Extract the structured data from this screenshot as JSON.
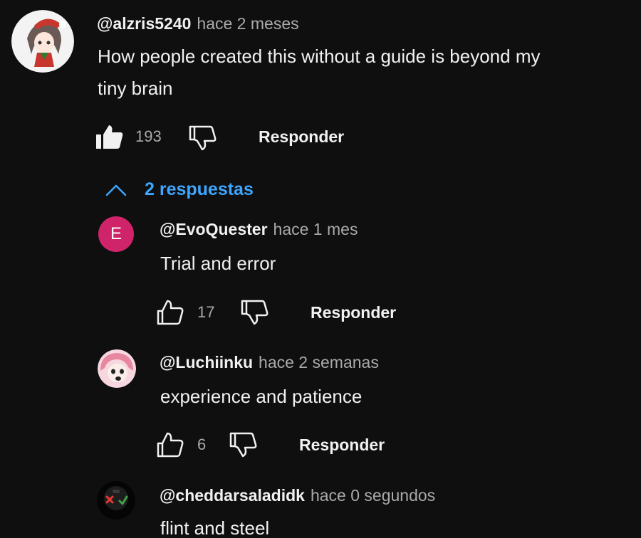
{
  "comment": {
    "handle": "@alzris5240",
    "time": "hace 2 meses",
    "text_line1": "How people created this without a guide is beyond my",
    "text_line2": "tiny brain",
    "likes": "193",
    "reply_label": "Responder",
    "liked": true
  },
  "replies_toggle": {
    "label": "2 respuestas"
  },
  "replies": [
    {
      "handle": "@EvoQuester",
      "time": "hace 1 mes",
      "text": "Trial and error",
      "likes": "17",
      "reply_label": "Responder",
      "avatar_letter": "E"
    },
    {
      "handle": "@Luchiinku",
      "time": "hace 2 semanas",
      "text": "experience and patience",
      "likes": "6",
      "reply_label": "Responder"
    },
    {
      "handle": "@cheddarsaladidk",
      "time": "hace 0 segundos",
      "text": "flint and steel"
    }
  ],
  "colors": {
    "background": "#0f0f0f",
    "link_blue": "#3ea6ff",
    "letter_avatar": "#d0246a",
    "secondary_text": "#aaaaaa"
  },
  "icons": {
    "like_filled": "thumbs-up-filled-icon",
    "like": "thumbs-up-icon",
    "dislike": "thumbs-down-icon",
    "chevron": "chevron-up-icon"
  }
}
